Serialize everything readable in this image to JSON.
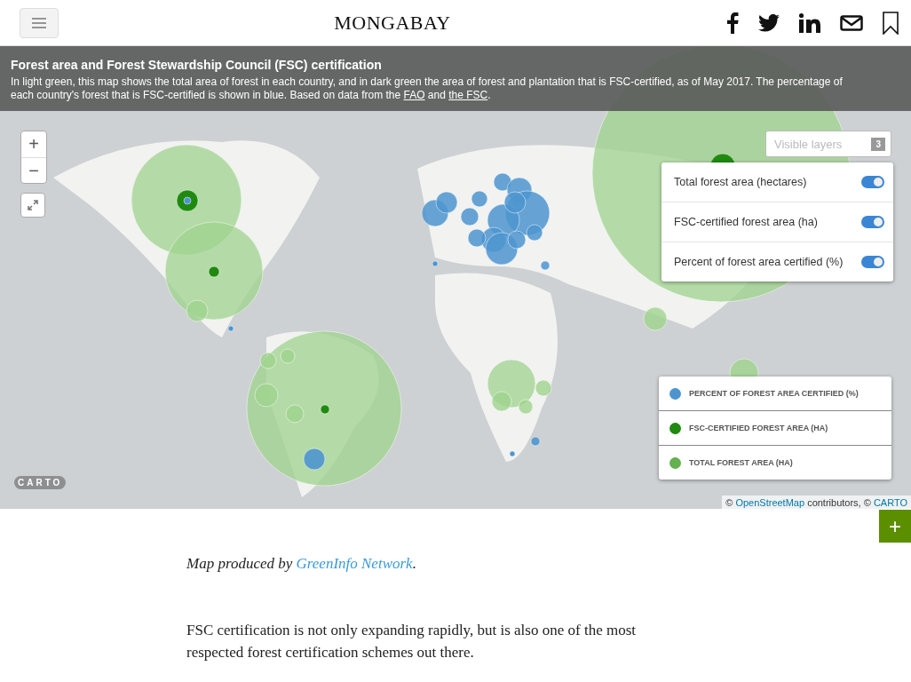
{
  "header": {
    "logo": "MONGABAY"
  },
  "map": {
    "title": "Forest area and Forest Stewardship Council (FSC) certification",
    "description": {
      "before": "In light green, this map shows the total area of forest in each country, and in dark green the area of forest and plantation that is FSC-certified, as of May 2017. The percentage of each country's forest that is FSC-certified is shown in blue. Based on data from the ",
      "link_1": "FAO",
      "middle": " and ",
      "link_2": "the FSC",
      "after": "."
    },
    "zoom_in": "+",
    "zoom_out": "−",
    "layers": {
      "placeholder": "Visible layers",
      "count": "3",
      "items": [
        {
          "label": "Total forest area (hectares)",
          "on": true
        },
        {
          "label": "FSC-certified forest area (ha)",
          "on": true
        },
        {
          "label": "Percent of forest area certified (%)",
          "on": true
        }
      ]
    },
    "legend": [
      {
        "label": "PERCENT OF FOREST AREA CERTIFIED (%)",
        "color": "#4e95cf"
      },
      {
        "label": "FSC-CERTIFIED FOREST AREA (HA)",
        "color": "#1f8a0f"
      },
      {
        "label": "TOTAL FOREST AREA (HA)",
        "color": "#63b14f"
      }
    ],
    "carto_logo": "CARTO",
    "attribution": {
      "prefix": "© ",
      "osm": "OpenStreetMap",
      "middle": " contributors, © ",
      "carto": "CARTO"
    }
  },
  "add_button": "+",
  "article": {
    "credit_before": "Map produced by ",
    "credit_link": "GreenInfo Network",
    "credit_after": ".",
    "paragraph": "FSC certification is not only expanding rapidly, but is also one of the most respected forest certification schemes out there."
  }
}
